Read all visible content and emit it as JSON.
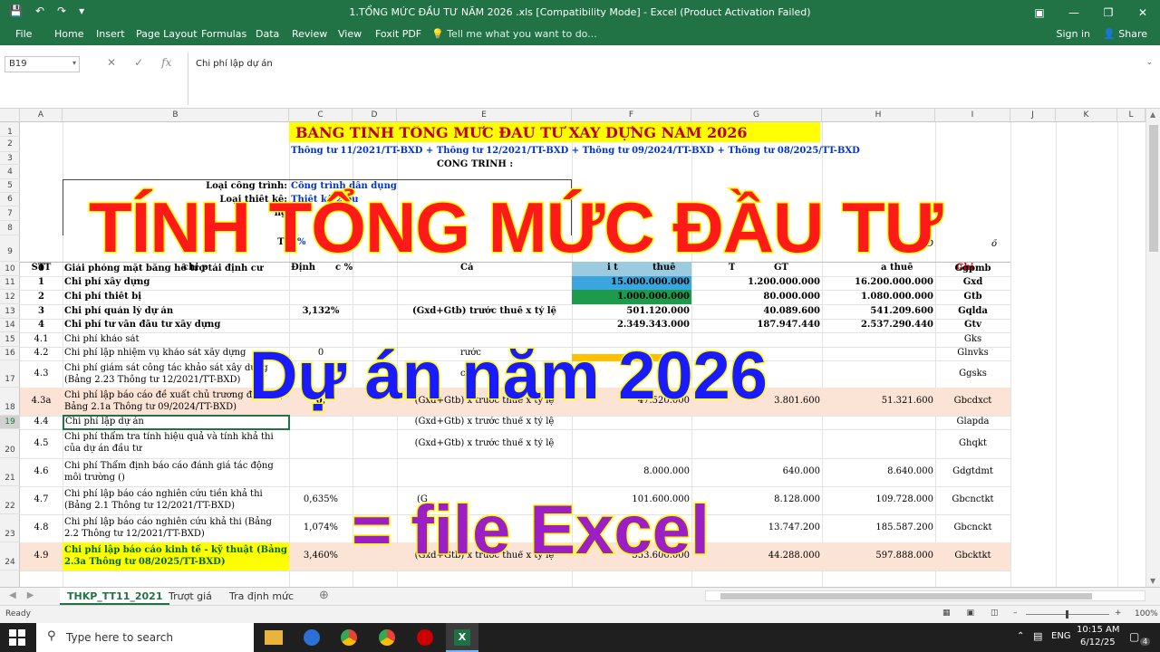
{
  "window": {
    "title": "1.TỔNG MỨC ĐẦU TƯ NĂM 2026 .xls  [Compatibility Mode] - Excel (Product Activation Failed)"
  },
  "ribbon": {
    "tabs": [
      "File",
      "Home",
      "Insert",
      "Page Layout",
      "Formulas",
      "Data",
      "Review",
      "View",
      "Foxit PDF"
    ],
    "tell_me": "Tell me what you want to do...",
    "sign_in": "Sign in",
    "share": "Share"
  },
  "formula_bar": {
    "name_box": "B19",
    "formula": "Chi phí lập dự án"
  },
  "columns": [
    "A",
    "B",
    "C",
    "D",
    "E",
    "F",
    "G",
    "H",
    "I",
    "J",
    "K",
    "L"
  ],
  "rows": [
    "1",
    "2",
    "3",
    "4",
    "5",
    "6",
    "7",
    "8",
    "9",
    "10",
    "11",
    "12",
    "13",
    "14",
    "15",
    "16",
    "17",
    "18",
    "19",
    "20",
    "21",
    "22",
    "23",
    "24"
  ],
  "sheet": {
    "title": "BẢNG TÍNH TỔNG MỨC ĐẦU TƯ XÂY DỰNG NĂM 2026",
    "subtitle": "Thông tư 11/2021/TT-BXD + Thông tư 12/2021/TT-BXD + Thông tư 09/2024/TT-BXD + Thông tư 08/2025/TT-BXD",
    "project_label": "CÔNG TRÌNH :",
    "info_label_1": "Loại công trình:",
    "info_value_1": "Công trình dân dụng",
    "info_label_2": "Loại thiết kế:",
    "info_value_2": "Thiết kế 2 bư",
    "info_row6": "ng",
    "vat_label": "T:",
    "vat_value": "8%",
    "unit_hint": "Đ",
    "unit_hint2": "ồ",
    "hdr_stt": "STT",
    "hdr_name": "chi p",
    "hdr_rate": "Định",
    "hdr_rate2": "c %",
    "hdr_formula": "Cá",
    "hdr_pre_tax": "i t",
    "hdr_pre_tax2": "thuế",
    "hdr_tax": "T",
    "hdr_tax2": "GT",
    "hdr_post_tax": "a thuế",
    "hdr_note": "Ghi",
    "items": [
      {
        "stt": "0",
        "name": "Giải phóng mặt bằng hỗ trợ tái định cư",
        "rate": "",
        "formula": "",
        "pre": "",
        "vat": "",
        "post": "",
        "code": "Ggpmb"
      },
      {
        "stt": "1",
        "name": "Chi phí xây dựng",
        "rate": "",
        "formula": "",
        "pre": "15.000.000.000",
        "vat": "1.200.000.000",
        "post": "16.200.000.000",
        "code": "Gxd"
      },
      {
        "stt": "2",
        "name": "Chi phí thiết bị",
        "rate": "",
        "formula": "",
        "pre": "1.000.000.000",
        "vat": "80.000.000",
        "post": "1.080.000.000",
        "code": "Gtb"
      },
      {
        "stt": "3",
        "name": "Chi phí quản lý dự án",
        "rate": "3,132%",
        "formula": "(Gxd+Gtb) trước thuế x tỷ lệ",
        "pre": "501.120.000",
        "vat": "40.089.600",
        "post": "541.209.600",
        "code": "Gqlda"
      },
      {
        "stt": "4",
        "name": "Chi phí tư vấn đầu tư xây dựng",
        "rate": "",
        "formula": "",
        "pre": "2.349.343.000",
        "vat": "187.947.440",
        "post": "2.537.290.440",
        "code": "Gtv"
      },
      {
        "stt": "4.1",
        "name": "Chi phí khảo sát",
        "rate": "",
        "formula": "",
        "pre": "",
        "vat": "",
        "post": "",
        "code": "Gks"
      },
      {
        "stt": "4.2",
        "name": "Chi phí lập nhiệm vụ khảo sát xây dựng",
        "rate": "0",
        "formula": "rước",
        "pre": "",
        "vat": "",
        "post": "",
        "code": "Glnvks"
      },
      {
        "stt": "4.3",
        "name": "Chi phí giám sát công tác khảo sát xây dựng (Bảng 2.23 Thông tư 12/2021/TT-BXD)",
        "rate": "",
        "formula": "c",
        "pre": "",
        "vat": "",
        "post": "",
        "code": "Ggsks"
      },
      {
        "stt": "4.3a",
        "name": "Chi phí lập báo cáo đề xuất chủ trương đầu tư ( Bảng 2.1a Thông tư 09/2024/TT-BXD)",
        "rate": "0,",
        "formula": "(Gxd+Gtb) x trước thuế x tỷ lệ",
        "pre": "47.520.000",
        "vat": "3.801.600",
        "post": "51.321.600",
        "code": "Gbcdxct"
      },
      {
        "stt": "4.4",
        "name": "Chi phí lập dự án",
        "rate": "",
        "formula": "(Gxd+Gtb) x trước thuế x tỷ lệ",
        "pre": "",
        "vat": "",
        "post": "",
        "code": "Glapda"
      },
      {
        "stt": "4.5",
        "name": "Chi phí thẩm tra tính hiệu quả và tính khả thi của dự án đầu tư",
        "rate": "",
        "formula": "(Gxd+Gtb) x trước thuế x tỷ lệ",
        "pre": "",
        "vat": "",
        "post": "",
        "code": "Ghqkt"
      },
      {
        "stt": "4.6",
        "name": "Chi phí Thẩm định báo cáo đánh giá tác động môi trường ()",
        "rate": "",
        "formula": "",
        "pre": "8.000.000",
        "vat": "640.000",
        "post": "8.640.000",
        "code": "Gdgtdmt"
      },
      {
        "stt": "4.7",
        "name": "Chi phí lập báo cáo nghiên cứu tiền khả thi (Bảng 2.1 Thông tư 12/2021/TT-BXD)",
        "rate": "0,635%",
        "formula": "(G",
        "pre": "101.600.000",
        "vat": "8.128.000",
        "post": "109.728.000",
        "code": "Gbcnctkt"
      },
      {
        "stt": "4.8",
        "name": "Chi phí lập báo cáo nghiên cứu khả thi (Bảng 2.2 Thông tư 12/2021/TT-BXD)",
        "rate": "1,074%",
        "formula": "(G",
        "pre": "",
        "vat": "13.747.200",
        "post": "185.587.200",
        "code": "Gbcnckt"
      },
      {
        "stt": "4.9",
        "name": "Chi phí lập báo cáo kinh tế - kỹ thuật (Bảng 2.3a Thông tư 08/2025/TT-BXD)",
        "rate": "3,460%",
        "formula": "(Gxd+Gtb) x trước thuế x tỷ lệ",
        "pre": "553.600.000",
        "vat": "44.288.000",
        "post": "597.888.000",
        "code": "Gbcktkt"
      }
    ]
  },
  "overlay": {
    "line1": "TÍNH TỔNG MỨC ĐẦU TƯ",
    "line2": "Dự án năm 2026",
    "line3": "= file Excel"
  },
  "sheet_tabs": [
    "THKP_TT11_2021",
    "Trượt giá",
    "Tra định mức"
  ],
  "status": {
    "ready": "Ready",
    "zoom": "100%"
  },
  "taskbar": {
    "search": "Type here to search",
    "lang": "ENG",
    "time": "10:15 AM",
    "date": "6/12/25",
    "notif": "4"
  },
  "colors": {
    "excel_green": "#217346",
    "title_yellow": "#ffff00",
    "overlay_red": "#ff1a1a",
    "overlay_blue": "#1a1aff",
    "overlay_purple": "#9b1fc4"
  }
}
